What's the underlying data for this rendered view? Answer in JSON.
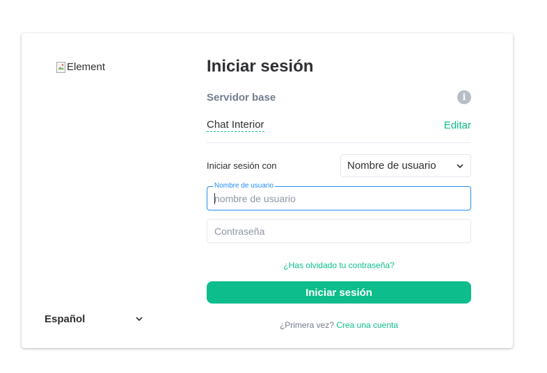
{
  "branding": {
    "logo_alt": "Element"
  },
  "language": {
    "selected": "Español",
    "icon": "chevron-down-icon"
  },
  "login": {
    "title": "Iniciar sesión",
    "homeserver": {
      "label": "Servidor base",
      "info_icon": "info-icon",
      "name": "Chat Interior",
      "edit_label": "Editar"
    },
    "sign_in_with": {
      "label": "Iniciar sesión con",
      "selected": "Nombre de usuario"
    },
    "username": {
      "label": "Nombre de usuario",
      "placeholder": "nombre de usuario",
      "value": ""
    },
    "password": {
      "placeholder": "Contraseña",
      "value": ""
    },
    "forgot_password": "¿Has olvidado tu contraseña?",
    "submit_label": "Iniciar sesión",
    "first_time": {
      "text": "¿Primera vez?",
      "link": "Crea una cuenta"
    }
  },
  "colors": {
    "accent": "#0dbd8b",
    "focus_border": "#238cf5",
    "muted_text": "#737d8c"
  }
}
